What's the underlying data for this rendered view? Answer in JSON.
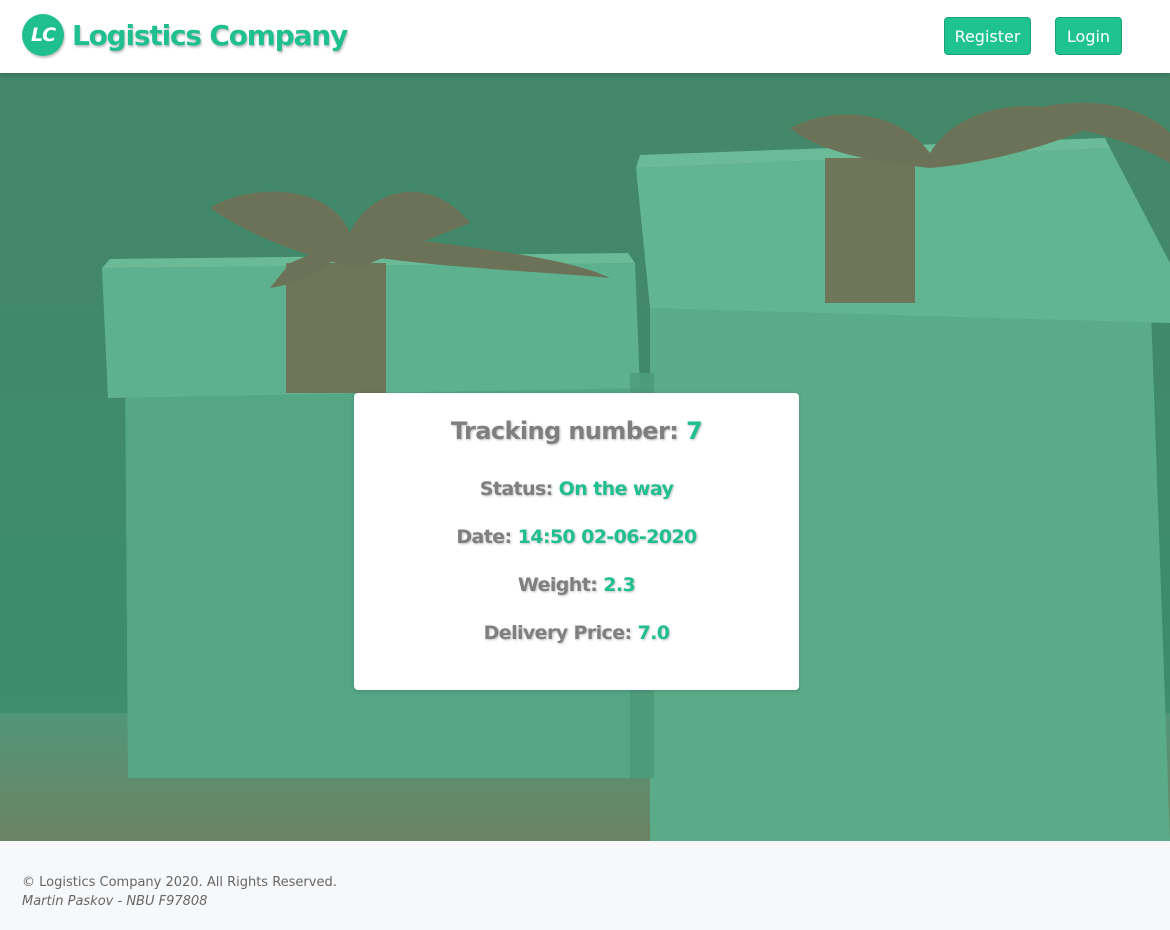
{
  "header": {
    "logo_text": "LC",
    "brand_name": "Logistics Company",
    "register_label": "Register",
    "login_label": "Login"
  },
  "tracking": {
    "title_label": "Tracking number:",
    "tracking_number": "7",
    "status_label": "Status:",
    "status_value": "On the way",
    "date_label": "Date:",
    "date_value": "14:50 02-06-2020",
    "weight_label": "Weight:",
    "weight_value": "2.3",
    "price_label": "Delivery Price:",
    "price_value": "7.0"
  },
  "footer": {
    "copyright": "© Logistics Company 2020. All Rights Reserved.",
    "author": "Martin Paskov - NBU F97808"
  },
  "colors": {
    "accent": "#1fbf8f",
    "hero_tint": "#4b8f71",
    "label_gray": "#7f7f7f"
  }
}
